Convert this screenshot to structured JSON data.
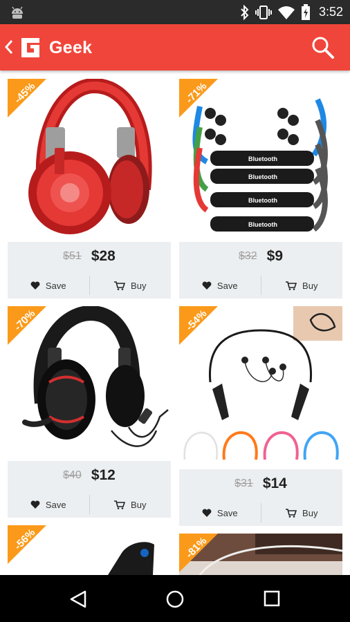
{
  "status_bar": {
    "time": "3:52"
  },
  "app_bar": {
    "title": "Geek"
  },
  "products": [
    {
      "discount": "-45%",
      "old_price": "$51",
      "price": "$28",
      "save_label": "Save",
      "buy_label": "Buy"
    },
    {
      "discount": "-71%",
      "old_price": "$32",
      "price": "$9",
      "save_label": "Save",
      "buy_label": "Buy",
      "image_text": "Bluetooth"
    },
    {
      "discount": "-70%",
      "old_price": "$40",
      "price": "$12",
      "save_label": "Save",
      "buy_label": "Buy"
    },
    {
      "discount": "-54%",
      "old_price": "$31",
      "price": "$14",
      "save_label": "Save",
      "buy_label": "Buy"
    },
    {
      "discount": "-56%"
    },
    {
      "discount": "-81%"
    }
  ],
  "colors": {
    "accent": "#f0453a",
    "badge": "#fb9a1a",
    "price_box": "#eceff1"
  },
  "icons": [
    "android-icon",
    "bluetooth-icon",
    "vibrate-icon",
    "wifi-icon",
    "battery-icon",
    "back-icon",
    "logo-icon",
    "search-icon",
    "heart-icon",
    "cart-icon",
    "nav-back-icon",
    "nav-home-icon",
    "nav-recents-icon"
  ]
}
